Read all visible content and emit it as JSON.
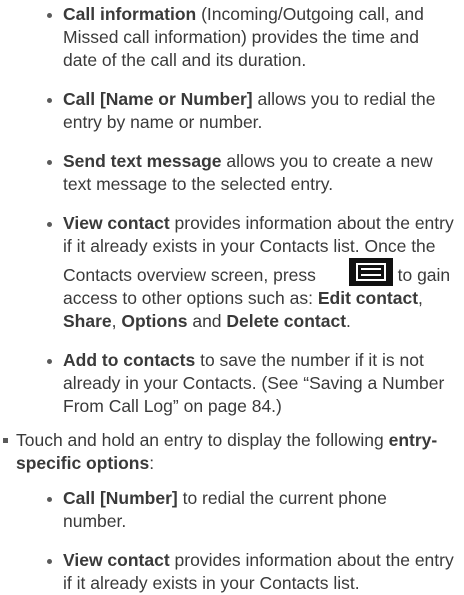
{
  "list1": [
    {
      "term": "Call information",
      "text": " (Incoming/Outgoing call, and Missed call information) provides the time and date of the call and its duration."
    },
    {
      "term": "Call [Name or Number]",
      "text": " allows you to redial the entry by name or number."
    },
    {
      "term": "Send text message",
      "text": " allows you to create a new text message to the selected entry."
    },
    {
      "term": "View contact",
      "text1": " provides information about the entry if it already exists in your Contacts list. Once the Contacts overview screen, press ",
      "icon": "menu-key-icon",
      "text2": " to gain access to other options such as: ",
      "opt1": "Edit contact",
      "sep1": ", ",
      "opt2": "Share",
      "sep2": ", ",
      "opt3": "Options",
      "sep3": " and ",
      "opt4": "Delete contact",
      "end": "."
    },
    {
      "term": "Add to contacts",
      "text": " to save the number if it is not already in your Contacts. (See “Saving a Number From Call Log” on page 84.)"
    }
  ],
  "main": {
    "text": "Touch and hold an entry to display the following ",
    "term": "entry-specific options",
    "end": ":"
  },
  "list2": [
    {
      "term": "Call [Number]",
      "text": " to redial the current phone number."
    },
    {
      "term": "View contact",
      "text": " provides information about the entry if it already exists in your Contacts list."
    }
  ],
  "colors": {
    "text": "#3a3a3a",
    "icon_bg": "#111111",
    "icon_fg": "#ffffff"
  }
}
